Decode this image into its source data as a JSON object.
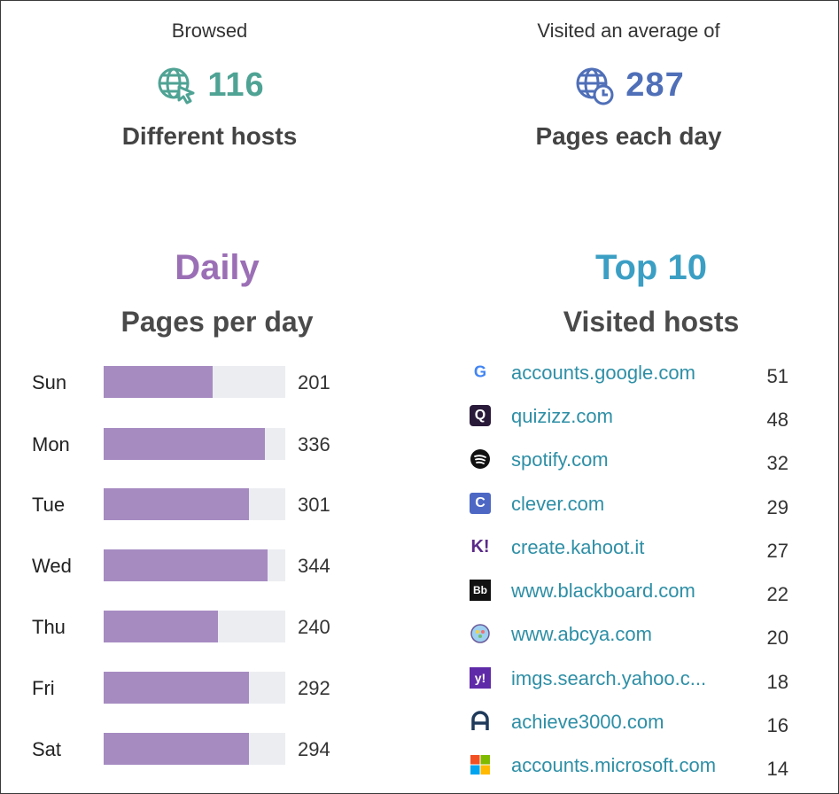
{
  "stats": {
    "hosts": {
      "caption": "Browsed",
      "value": "116",
      "label": "Different hosts",
      "color": "#4fa394",
      "icon": "globe-cursor-icon"
    },
    "pages": {
      "caption": "Visited an average of",
      "value": "287",
      "label": "Pages each day",
      "color": "#4f6fb8",
      "icon": "globe-clock-icon"
    }
  },
  "daily": {
    "title": "Daily",
    "subtitle": "Pages per day",
    "title_color": "#9b6fb5",
    "bar_color": "#a68bc1",
    "max_value": 344,
    "days": [
      {
        "day": "Sun",
        "value": 201,
        "fill": 0.6
      },
      {
        "day": "Mon",
        "value": 336,
        "fill": 0.89
      },
      {
        "day": "Tue",
        "value": 301,
        "fill": 0.8
      },
      {
        "day": "Wed",
        "value": 344,
        "fill": 0.9
      },
      {
        "day": "Thu",
        "value": 240,
        "fill": 0.63
      },
      {
        "day": "Fri",
        "value": 292,
        "fill": 0.8
      },
      {
        "day": "Sat",
        "value": 294,
        "fill": 0.8
      }
    ]
  },
  "top": {
    "title": "Top 10",
    "subtitle": "Visited hosts",
    "title_color": "#3b9fc4",
    "hosts": [
      {
        "name": "accounts.google.com",
        "count": "51",
        "icon": "google-icon"
      },
      {
        "name": "quizizz.com",
        "count": "48",
        "icon": "quizizz-icon"
      },
      {
        "name": "spotify.com",
        "count": "32",
        "icon": "spotify-icon"
      },
      {
        "name": "clever.com",
        "count": "29",
        "icon": "clever-icon"
      },
      {
        "name": "create.kahoot.it",
        "count": "27",
        "icon": "kahoot-icon"
      },
      {
        "name": "www.blackboard.com",
        "count": "22",
        "icon": "blackboard-icon"
      },
      {
        "name": "www.abcya.com",
        "count": "20",
        "icon": "abcya-icon"
      },
      {
        "name": "imgs.search.yahoo.c...",
        "count": "18",
        "icon": "yahoo-icon"
      },
      {
        "name": "achieve3000.com",
        "count": "16",
        "icon": "achieve3000-icon"
      },
      {
        "name": "accounts.microsoft.com",
        "count": "14",
        "icon": "microsoft-icon"
      }
    ]
  }
}
